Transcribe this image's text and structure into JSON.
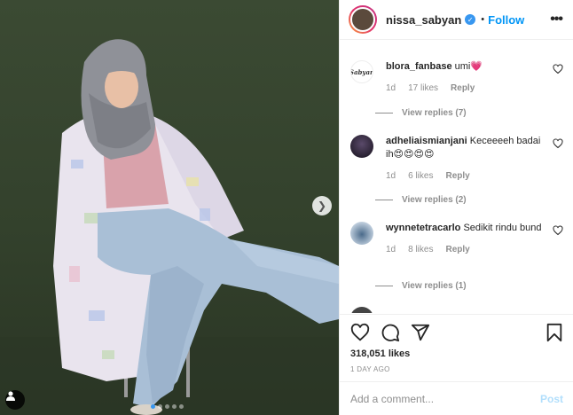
{
  "post": {
    "username": "nissa_sabyan",
    "follow_label": "Follow",
    "separator": "•",
    "verified": true,
    "likes": "318,051 likes",
    "time_ago": "1 DAY AGO",
    "image_count": 5,
    "active_image": 0
  },
  "comments": [
    {
      "avatar": "Sabyan",
      "user": "blora_fanbase",
      "text": "umi💗",
      "age": "1d",
      "likes": "17 likes",
      "reply": "Reply",
      "view_replies": "View replies (7)"
    },
    {
      "user": "adheliaismianjani",
      "text": "Keceeeeh badai ih😍😍😍😍",
      "age": "1d",
      "likes": "6 likes",
      "reply": "Reply",
      "view_replies": "View replies (2)"
    },
    {
      "user": "wynnetetracarlo",
      "text": "Sedikit rindu bund",
      "age": "1d",
      "likes": "8 likes",
      "reply": "Reply",
      "view_replies": "View replies (1)"
    }
  ],
  "add_comment": {
    "placeholder": "Add a comment...",
    "post_label": "Post"
  },
  "icons": {
    "like": "heart-icon",
    "comment": "comment-icon",
    "share": "share-icon",
    "save": "bookmark-icon",
    "more": "more-options-icon",
    "next": "chevron-right-icon",
    "tag": "user-tag-icon"
  },
  "colors": {
    "accent": "#0095f6",
    "verified": "#3897f0",
    "muted": "#8e8e8e",
    "post_disabled": "#b2dffc",
    "wall": "#3b4a33"
  }
}
